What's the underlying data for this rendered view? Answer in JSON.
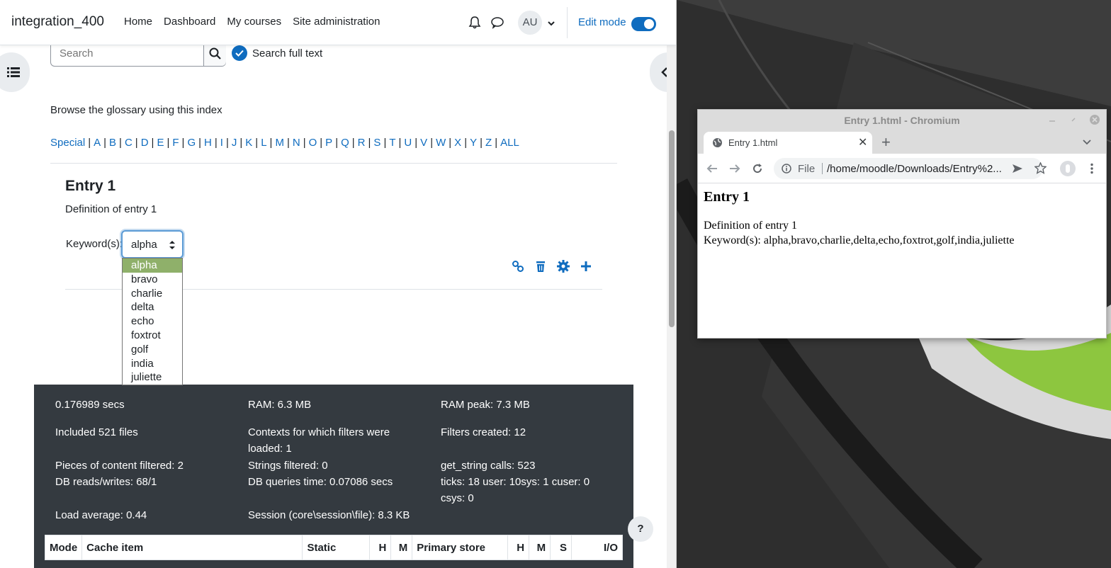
{
  "moodle": {
    "brand": "integration_400",
    "nav": [
      "Home",
      "Dashboard",
      "My courses",
      "Site administration"
    ],
    "user_initials": "AU",
    "edit_mode_label": "Edit mode",
    "search_placeholder": "Search",
    "search_full_text_label": "Search full text",
    "browse_label": "Browse the glossary using this index",
    "alphabet": [
      "Special",
      "A",
      "B",
      "C",
      "D",
      "E",
      "F",
      "G",
      "H",
      "I",
      "J",
      "K",
      "L",
      "M",
      "N",
      "O",
      "P",
      "Q",
      "R",
      "S",
      "T",
      "U",
      "V",
      "W",
      "X",
      "Y",
      "Z",
      "ALL"
    ],
    "entry": {
      "title": "Entry 1",
      "definition": "Definition of entry 1",
      "keywords_label": "Keyword(s):",
      "keyword_selected": "alpha",
      "keyword_options": [
        "alpha",
        "bravo",
        "charlie",
        "delta",
        "echo",
        "foxtrot",
        "golf",
        "india",
        "juliette"
      ]
    },
    "perf": {
      "secs": "0.176989 secs",
      "ram": "RAM: 6.3 MB",
      "ram_peak": "RAM peak: 7.3 MB",
      "included_files": "Included 521 files",
      "contexts_filters": "Contexts for which filters were loaded: 1",
      "filters_created": "Filters created: 12",
      "pieces_filtered": "Pieces of content filtered: 2",
      "strings_filtered": "Strings filtered: 0",
      "get_string_calls": "get_string calls: 523",
      "db_reads_writes": "DB reads/writes: 68/1",
      "db_queries_time": "DB queries time: 0.07086 secs",
      "ticks": "ticks: 18 user: 10sys: 1 cuser: 0 csys: 0",
      "load_average": "Load average: 0.44",
      "session": "Session (core\\session\\file): 8.3 KB"
    },
    "cache_table_headers": [
      "Mode",
      "Cache item",
      "Static",
      "H",
      "M",
      "Primary store",
      "H",
      "M",
      "S",
      "I/O"
    ],
    "help_label": "?"
  },
  "chromium": {
    "window_title": "Entry 1.html - Chromium",
    "tab_title": "Entry 1.html",
    "url_scheme": "File",
    "url": "/home/moodle/Downloads/Entry%2...",
    "page": {
      "heading": "Entry 1",
      "definition": "Definition of entry 1",
      "keywords": "Keyword(s): alpha,bravo,charlie,delta,echo,foxtrot,golf,india,juliette"
    }
  },
  "colors": {
    "link": "#0f6cbf",
    "perf_bg": "#343a40",
    "dropdown_selected": "#8fb06a"
  }
}
